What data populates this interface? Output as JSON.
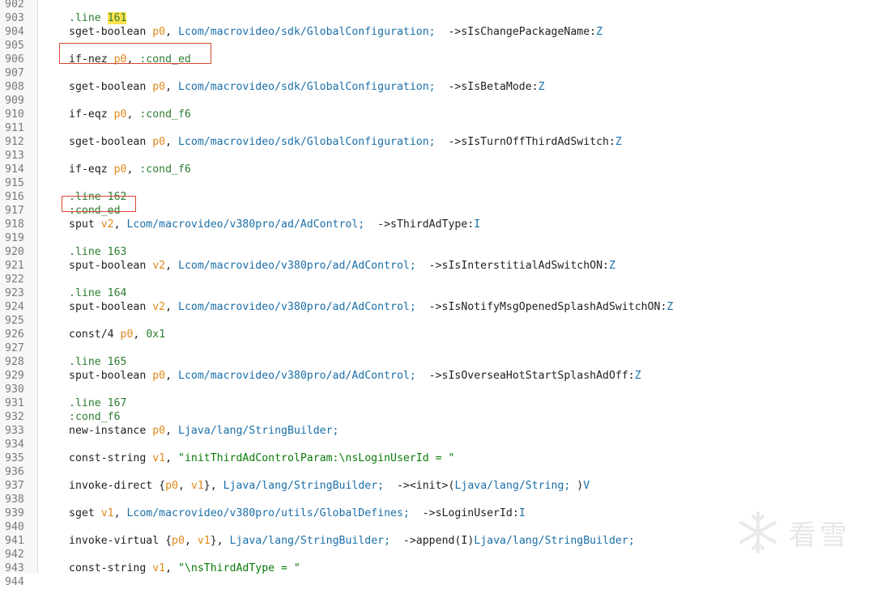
{
  "colors": {
    "keyword": "#2e7d32",
    "opcode": "#1f1f1f",
    "register": "#e0891a",
    "type": "#1a6fa8",
    "string": "#0a7a0a",
    "member": "#1f1f1f",
    "highlight": "#ffe14d",
    "redbox": "#d9452f"
  },
  "lines": [
    {
      "n": "902",
      "t": []
    },
    {
      "n": "903",
      "t": [
        {
          "c": "k",
          "s": ".line "
        },
        {
          "c": "hl",
          "s": "161"
        }
      ]
    },
    {
      "n": "904",
      "t": [
        {
          "c": "o",
          "s": "sget-boolean "
        },
        {
          "c": "r",
          "s": "p0"
        },
        {
          "c": "o",
          "s": ", "
        },
        {
          "c": "ty",
          "s": "Lcom/macrovideo/sdk/GlobalConfiguration;"
        },
        {
          "c": "o",
          "s": "  ->sIsChangePackageName:"
        },
        {
          "c": "ty",
          "s": "Z"
        }
      ]
    },
    {
      "n": "905",
      "t": []
    },
    {
      "n": "906",
      "t": [
        {
          "c": "o",
          "s": "if-nez "
        },
        {
          "c": "r",
          "s": "p0"
        },
        {
          "c": "o",
          "s": ", "
        },
        {
          "c": "k",
          "s": ":cond_ed"
        }
      ]
    },
    {
      "n": "907",
      "t": []
    },
    {
      "n": "908",
      "t": [
        {
          "c": "o",
          "s": "sget-boolean "
        },
        {
          "c": "r",
          "s": "p0"
        },
        {
          "c": "o",
          "s": ", "
        },
        {
          "c": "ty",
          "s": "Lcom/macrovideo/sdk/GlobalConfiguration;"
        },
        {
          "c": "o",
          "s": "  ->sIsBetaMode:"
        },
        {
          "c": "ty",
          "s": "Z"
        }
      ]
    },
    {
      "n": "909",
      "t": []
    },
    {
      "n": "910",
      "t": [
        {
          "c": "o",
          "s": "if-eqz "
        },
        {
          "c": "r",
          "s": "p0"
        },
        {
          "c": "o",
          "s": ", "
        },
        {
          "c": "k",
          "s": ":cond_f6"
        }
      ]
    },
    {
      "n": "911",
      "t": []
    },
    {
      "n": "912",
      "t": [
        {
          "c": "o",
          "s": "sget-boolean "
        },
        {
          "c": "r",
          "s": "p0"
        },
        {
          "c": "o",
          "s": ", "
        },
        {
          "c": "ty",
          "s": "Lcom/macrovideo/sdk/GlobalConfiguration;"
        },
        {
          "c": "o",
          "s": "  ->sIsTurnOffThirdAdSwitch:"
        },
        {
          "c": "ty",
          "s": "Z"
        }
      ]
    },
    {
      "n": "913",
      "t": []
    },
    {
      "n": "914",
      "t": [
        {
          "c": "o",
          "s": "if-eqz "
        },
        {
          "c": "r",
          "s": "p0"
        },
        {
          "c": "o",
          "s": ", "
        },
        {
          "c": "k",
          "s": ":cond_f6"
        }
      ]
    },
    {
      "n": "915",
      "t": []
    },
    {
      "n": "916",
      "t": [
        {
          "c": "k",
          "s": ".line 162"
        }
      ]
    },
    {
      "n": "917",
      "t": [
        {
          "c": "k",
          "s": ":cond_ed"
        }
      ]
    },
    {
      "n": "918",
      "t": [
        {
          "c": "o",
          "s": "sput "
        },
        {
          "c": "r",
          "s": "v2"
        },
        {
          "c": "o",
          "s": ", "
        },
        {
          "c": "ty",
          "s": "Lcom/macrovideo/v380pro/ad/AdControl;"
        },
        {
          "c": "o",
          "s": "  ->sThirdAdType:"
        },
        {
          "c": "ty",
          "s": "I"
        }
      ]
    },
    {
      "n": "919",
      "t": []
    },
    {
      "n": "920",
      "t": [
        {
          "c": "k",
          "s": ".line 163"
        }
      ]
    },
    {
      "n": "921",
      "t": [
        {
          "c": "o",
          "s": "sput-boolean "
        },
        {
          "c": "r",
          "s": "v2"
        },
        {
          "c": "o",
          "s": ", "
        },
        {
          "c": "ty",
          "s": "Lcom/macrovideo/v380pro/ad/AdControl;"
        },
        {
          "c": "o",
          "s": "  ->sIsInterstitialAdSwitchON:"
        },
        {
          "c": "ty",
          "s": "Z"
        }
      ]
    },
    {
      "n": "922",
      "t": []
    },
    {
      "n": "923",
      "t": [
        {
          "c": "k",
          "s": ".line 164"
        }
      ]
    },
    {
      "n": "924",
      "t": [
        {
          "c": "o",
          "s": "sput-boolean "
        },
        {
          "c": "r",
          "s": "v2"
        },
        {
          "c": "o",
          "s": ", "
        },
        {
          "c": "ty",
          "s": "Lcom/macrovideo/v380pro/ad/AdControl;"
        },
        {
          "c": "o",
          "s": "  ->sIsNotifyMsgOpenedSplashAdSwitchON:"
        },
        {
          "c": "ty",
          "s": "Z"
        }
      ]
    },
    {
      "n": "925",
      "t": []
    },
    {
      "n": "926",
      "t": [
        {
          "c": "o",
          "s": "const/4 "
        },
        {
          "c": "r",
          "s": "p0"
        },
        {
          "c": "o",
          "s": ", "
        },
        {
          "c": "k",
          "s": "0x1"
        }
      ]
    },
    {
      "n": "927",
      "t": []
    },
    {
      "n": "928",
      "t": [
        {
          "c": "k",
          "s": ".line 165"
        }
      ]
    },
    {
      "n": "929",
      "t": [
        {
          "c": "o",
          "s": "sput-boolean "
        },
        {
          "c": "r",
          "s": "p0"
        },
        {
          "c": "o",
          "s": ", "
        },
        {
          "c": "ty",
          "s": "Lcom/macrovideo/v380pro/ad/AdControl;"
        },
        {
          "c": "o",
          "s": "  ->sIsOverseaHotStartSplashAdOff:"
        },
        {
          "c": "ty",
          "s": "Z"
        }
      ]
    },
    {
      "n": "930",
      "t": []
    },
    {
      "n": "931",
      "t": [
        {
          "c": "k",
          "s": ".line 167"
        }
      ]
    },
    {
      "n": "932",
      "t": [
        {
          "c": "k",
          "s": ":cond_f6"
        }
      ]
    },
    {
      "n": "933",
      "t": [
        {
          "c": "o",
          "s": "new-instance "
        },
        {
          "c": "r",
          "s": "p0"
        },
        {
          "c": "o",
          "s": ", "
        },
        {
          "c": "ty",
          "s": "Ljava/lang/StringBuilder;"
        }
      ]
    },
    {
      "n": "934",
      "t": []
    },
    {
      "n": "935",
      "t": [
        {
          "c": "o",
          "s": "const-string "
        },
        {
          "c": "r",
          "s": "v1"
        },
        {
          "c": "o",
          "s": ", "
        },
        {
          "c": "s",
          "s": "\"initThirdAdControlParam:\\nsLoginUserId = \""
        }
      ]
    },
    {
      "n": "936",
      "t": []
    },
    {
      "n": "937",
      "t": [
        {
          "c": "o",
          "s": "invoke-direct {"
        },
        {
          "c": "r",
          "s": "p0"
        },
        {
          "c": "o",
          "s": ", "
        },
        {
          "c": "r",
          "s": "v1"
        },
        {
          "c": "o",
          "s": "}, "
        },
        {
          "c": "ty",
          "s": "Ljava/lang/StringBuilder;"
        },
        {
          "c": "o",
          "s": "  -><init>("
        },
        {
          "c": "ty",
          "s": "Ljava/lang/String;"
        },
        {
          "c": "o",
          "s": " )"
        },
        {
          "c": "ty",
          "s": "V"
        }
      ]
    },
    {
      "n": "938",
      "t": []
    },
    {
      "n": "939",
      "t": [
        {
          "c": "o",
          "s": "sget "
        },
        {
          "c": "r",
          "s": "v1"
        },
        {
          "c": "o",
          "s": ", "
        },
        {
          "c": "ty",
          "s": "Lcom/macrovideo/v380pro/utils/GlobalDefines;"
        },
        {
          "c": "o",
          "s": "  ->sLoginUserId:"
        },
        {
          "c": "ty",
          "s": "I"
        }
      ]
    },
    {
      "n": "940",
      "t": []
    },
    {
      "n": "941",
      "t": [
        {
          "c": "o",
          "s": "invoke-virtual {"
        },
        {
          "c": "r",
          "s": "p0"
        },
        {
          "c": "o",
          "s": ", "
        },
        {
          "c": "r",
          "s": "v1"
        },
        {
          "c": "o",
          "s": "}, "
        },
        {
          "c": "ty",
          "s": "Ljava/lang/StringBuilder;"
        },
        {
          "c": "o",
          "s": "  ->append(I)"
        },
        {
          "c": "ty",
          "s": "Ljava/lang/StringBuilder;"
        }
      ]
    },
    {
      "n": "942",
      "t": []
    },
    {
      "n": "943",
      "t": [
        {
          "c": "o",
          "s": "const-string "
        },
        {
          "c": "r",
          "s": "v1"
        },
        {
          "c": "o",
          "s": ", "
        },
        {
          "c": "s",
          "s": "\"\\nsThirdAdType = \""
        }
      ]
    },
    {
      "n": "944",
      "t": []
    }
  ],
  "watermark": {
    "text": "看雪",
    "icon": "snowflake-icon"
  }
}
